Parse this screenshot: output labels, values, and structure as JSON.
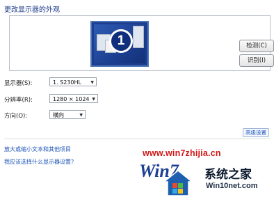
{
  "page": {
    "title": "更改显示器的外观"
  },
  "preview": {
    "monitor_number": "1"
  },
  "buttons": {
    "detect": "检测(C)",
    "identify": "识别(I)",
    "advanced": "高级设置"
  },
  "fields": {
    "display": {
      "label": "显示器(S):",
      "value": "1. S230HL"
    },
    "resolution": {
      "label": "分辨率(R):",
      "value": "1280 × 1024"
    },
    "orientation": {
      "label": "方向(O):",
      "value": "横向"
    }
  },
  "links": [
    {
      "text": "放大或缩小文本和其他项目"
    },
    {
      "text": "我应该选择什么显示器设置?"
    }
  ],
  "watermark": {
    "url": "www.win7zhijia.cn",
    "logo_text": "Win7",
    "brand": "系统之家",
    "site": "Win10net.com"
  }
}
